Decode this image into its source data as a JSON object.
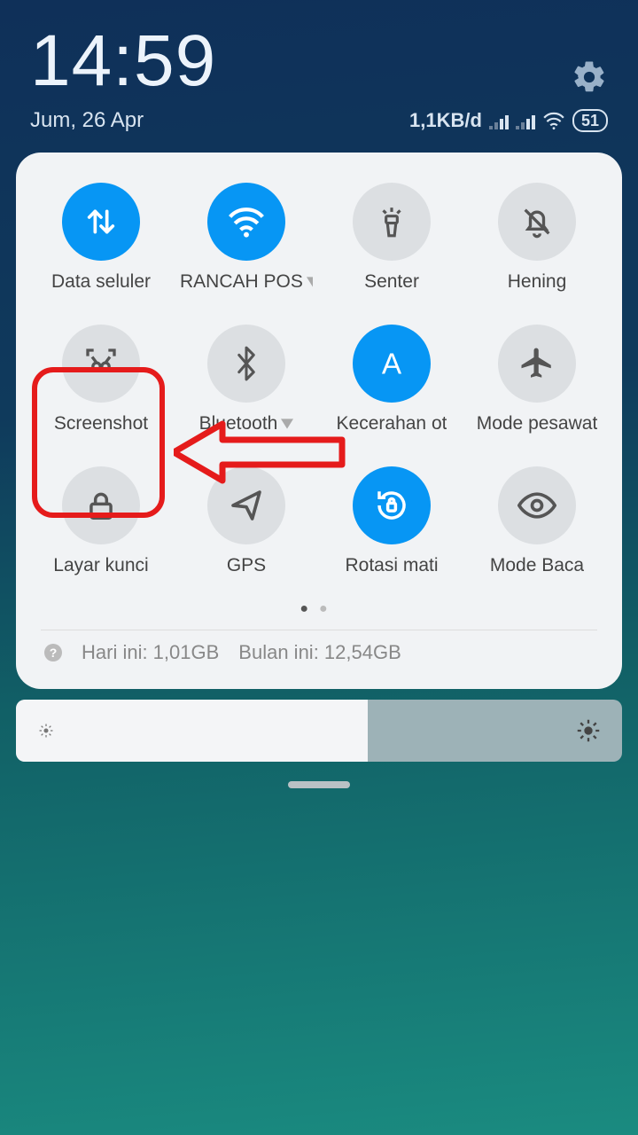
{
  "status": {
    "time": "14:59",
    "date": "Jum, 26 Apr",
    "data_rate": "1,1KB/d",
    "battery": "51"
  },
  "tiles": [
    {
      "label": "Data seluler",
      "icon": "data",
      "active": true,
      "expandable": false
    },
    {
      "label": "RANCAH POS",
      "icon": "wifi",
      "active": true,
      "expandable": true
    },
    {
      "label": "Senter",
      "icon": "torch",
      "active": false,
      "expandable": false
    },
    {
      "label": "Hening",
      "icon": "dnd",
      "active": false,
      "expandable": false
    },
    {
      "label": "Screenshot",
      "icon": "shot",
      "active": false,
      "expandable": false
    },
    {
      "label": "Bluetooth",
      "icon": "bt",
      "active": false,
      "expandable": true
    },
    {
      "label": "Kecerahan ot",
      "icon": "autoA",
      "active": true,
      "expandable": false
    },
    {
      "label": "Mode pesawat",
      "icon": "plane",
      "active": false,
      "expandable": false
    },
    {
      "label": "Layar kunci",
      "icon": "lock",
      "active": false,
      "expandable": false
    },
    {
      "label": "GPS",
      "icon": "nav",
      "active": false,
      "expandable": false
    },
    {
      "label": "Rotasi mati",
      "icon": "rotlock",
      "active": true,
      "expandable": false
    },
    {
      "label": "Mode Baca",
      "icon": "eye",
      "active": false,
      "expandable": false
    }
  ],
  "usage": {
    "today_label": "Hari ini: 1,01GB",
    "month_label": "Bulan ini: 12,54GB"
  },
  "brightness_pct": 58
}
